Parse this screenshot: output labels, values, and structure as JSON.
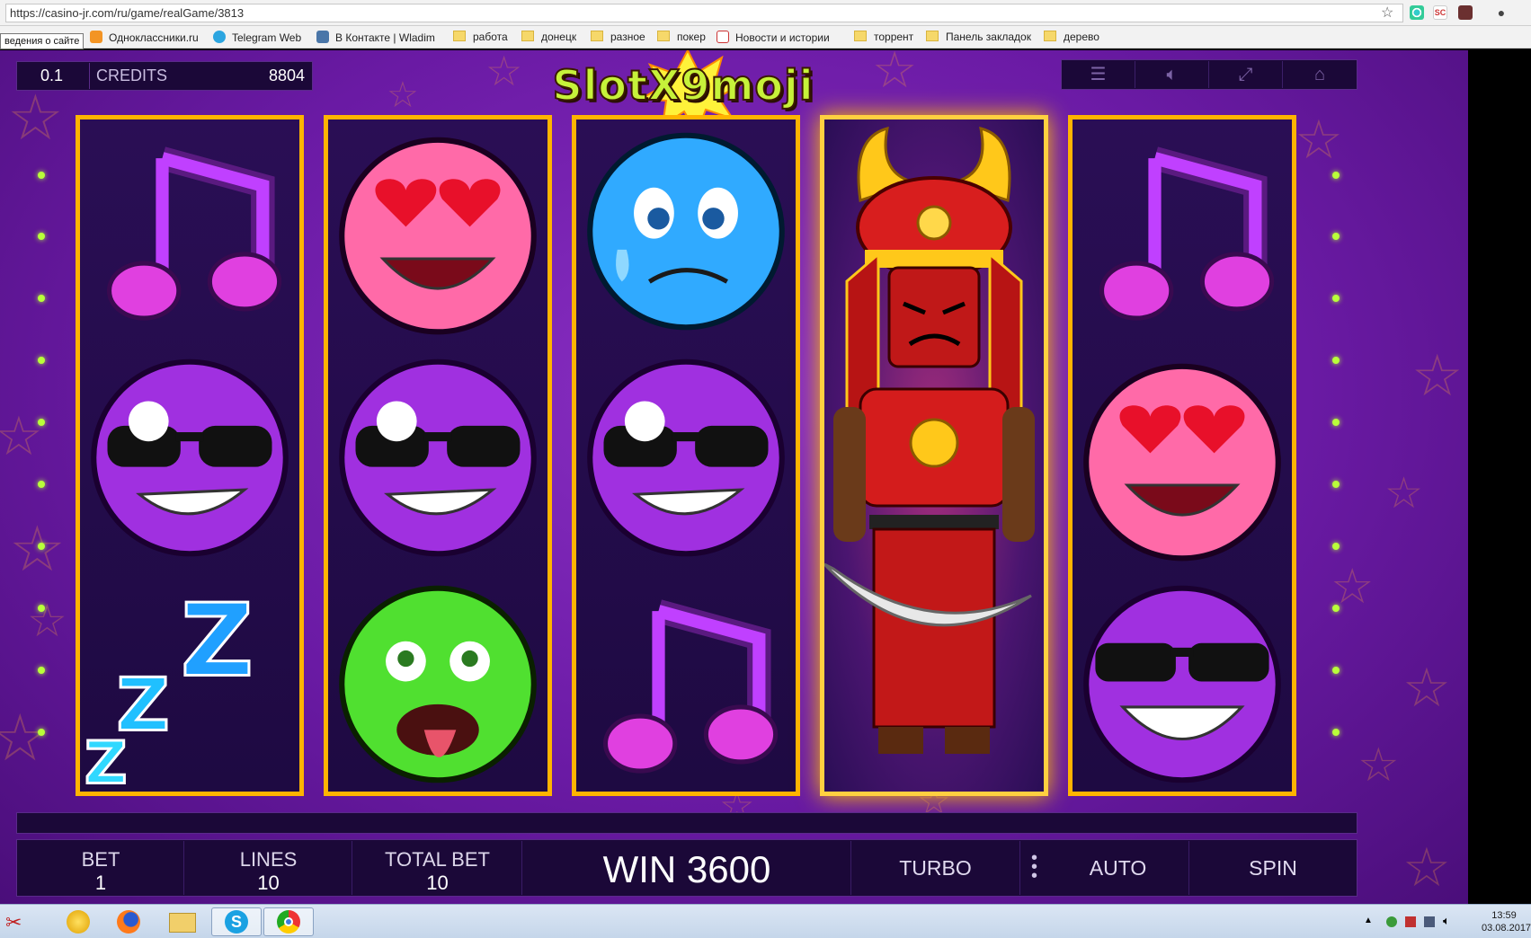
{
  "browser": {
    "url": "https://casino-jr.com/ru/game/realGame/3813",
    "tooltip": "ведения о сайте",
    "bookmarks": [
      {
        "label": "Одноклассники.ru",
        "icon": "odnoklassniki-icon"
      },
      {
        "label": "Telegram Web",
        "icon": "telegram-icon"
      },
      {
        "label": "В Контакте | Wladim",
        "icon": "vk-icon"
      },
      {
        "label": "работа",
        "icon": "folder-icon"
      },
      {
        "label": "донецк",
        "icon": "folder-icon"
      },
      {
        "label": "разное",
        "icon": "folder-icon"
      },
      {
        "label": "покер",
        "icon": "folder-icon"
      },
      {
        "label": "Новости и истории",
        "icon": "news-icon"
      },
      {
        "label": "торрент",
        "icon": "folder-icon"
      },
      {
        "label": "Панель закладок",
        "icon": "folder-icon"
      },
      {
        "label": "дерево",
        "icon": "folder-icon"
      }
    ]
  },
  "game": {
    "logo": "SlotX9moji",
    "coin_value": "0.1",
    "credits_label": "CREDITS",
    "credits_value": "8804",
    "top_buttons": [
      {
        "name": "menu",
        "icon": "hamburger-icon"
      },
      {
        "name": "sound",
        "icon": "speaker-icon"
      },
      {
        "name": "fullscreen",
        "icon": "fullscreen-icon"
      },
      {
        "name": "home",
        "icon": "home-icon"
      }
    ],
    "reels": [
      [
        "music-note",
        "cool-sunglasses",
        "sleepy-zzz"
      ],
      [
        "heart-eyes",
        "cool-sunglasses",
        "sick-green"
      ],
      [
        "crying-blue",
        "cool-sunglasses",
        "music-note"
      ],
      [
        "samurai-wild",
        "samurai-wild",
        "samurai-wild"
      ],
      [
        "music-note",
        "heart-eyes",
        "sunglasses-grin"
      ]
    ],
    "winning_reel": 4,
    "bottom": {
      "bet_label": "BET",
      "bet_value": "1",
      "lines_label": "LINES",
      "lines_value": "10",
      "total_bet_label": "TOTAL BET",
      "total_bet_value": "10",
      "win_text": "WIN 3600",
      "turbo_label": "TURBO",
      "auto_label": "AUTO",
      "spin_label": "SPIN"
    },
    "colors": {
      "background": "#6a1aa4",
      "reel_border": "#ffb400",
      "line_dots": "#b9ff3a"
    }
  },
  "taskbar": {
    "apps": [
      "snipping-tool-icon",
      "messenger-icon",
      "firefox-icon",
      "file-explorer-icon",
      "skype-icon",
      "chrome-icon"
    ],
    "time": "13:59",
    "date": "03.08.2017"
  }
}
